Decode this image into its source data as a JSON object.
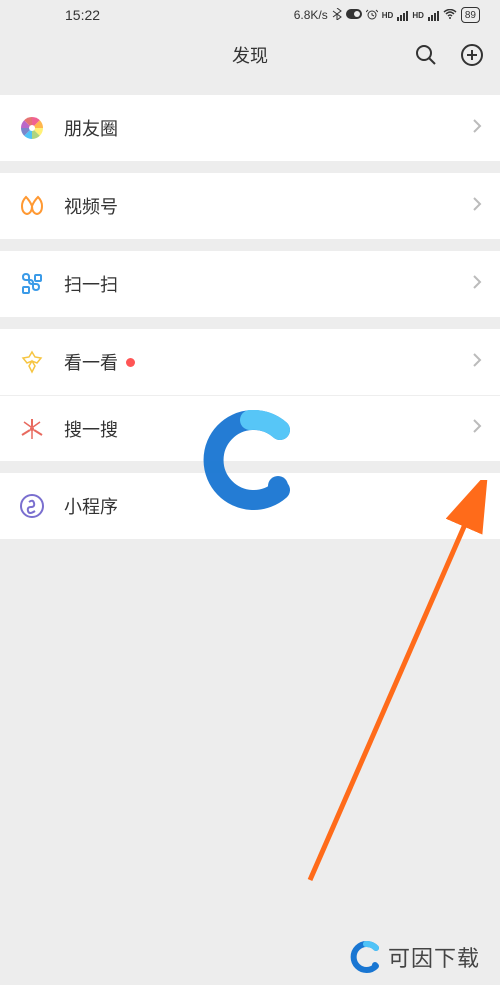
{
  "status": {
    "time": "15:22",
    "network_speed": "6.8K/s",
    "battery": "89"
  },
  "header": {
    "title": "发现"
  },
  "menu": {
    "moments": "朋友圈",
    "channels": "视频号",
    "scan": "扫一扫",
    "top_stories": "看一看",
    "search": "搜一搜",
    "mini_programs": "小程序"
  },
  "footer": {
    "brand": "可因下载"
  }
}
